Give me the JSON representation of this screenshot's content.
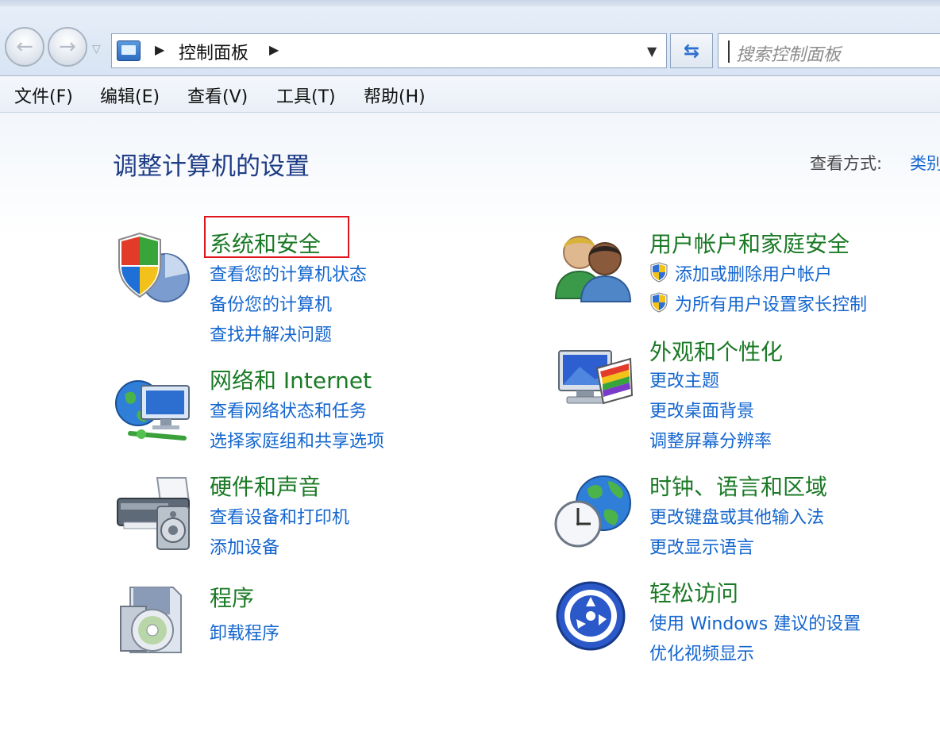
{
  "address": {
    "breadcrumb": "控制面板",
    "search_placeholder": "搜索控制面板"
  },
  "menu": [
    {
      "label": "文件(F)"
    },
    {
      "label": "编辑(E)"
    },
    {
      "label": "查看(V)"
    },
    {
      "label": "工具(T)"
    },
    {
      "label": "帮助(H)"
    }
  ],
  "page": {
    "title": "调整计算机的设置",
    "view_by_label": "查看方式:",
    "view_by_value": "类别"
  },
  "categories": [
    {
      "title": "系统和安全",
      "icon": "shield-icon",
      "highlighted": true,
      "links": [
        "查看您的计算机状态",
        "备份您的计算机",
        "查找并解决问题"
      ]
    },
    {
      "title": "网络和 Internet",
      "icon": "network-globe-icon",
      "links": [
        "查看网络状态和任务",
        "选择家庭组和共享选项"
      ]
    },
    {
      "title": "硬件和声音",
      "icon": "printer-speaker-icon",
      "links": [
        "查看设备和打印机",
        "添加设备"
      ]
    },
    {
      "title": "程序",
      "icon": "programs-disc-icon",
      "links": [
        "卸载程序"
      ]
    },
    {
      "title": "用户帐户和家庭安全",
      "icon": "users-icon",
      "links": [
        "添加或删除用户帐户",
        "为所有用户设置家长控制"
      ]
    },
    {
      "title": "外观和个性化",
      "icon": "monitor-palette-icon",
      "links": [
        "更改主题",
        "更改桌面背景",
        "调整屏幕分辨率"
      ]
    },
    {
      "title": "时钟、语言和区域",
      "icon": "clock-globe-icon",
      "links": [
        "更改键盘或其他输入法",
        "更改显示语言"
      ]
    },
    {
      "title": "轻松访问",
      "icon": "ease-of-access-icon",
      "links": [
        "使用 Windows 建议的设置",
        "优化视频显示"
      ]
    }
  ],
  "colors": {
    "category_title": "#1b7a26",
    "link": "#1466cf",
    "page_title": "#1e3c86",
    "highlight_border": "#e0141c"
  }
}
